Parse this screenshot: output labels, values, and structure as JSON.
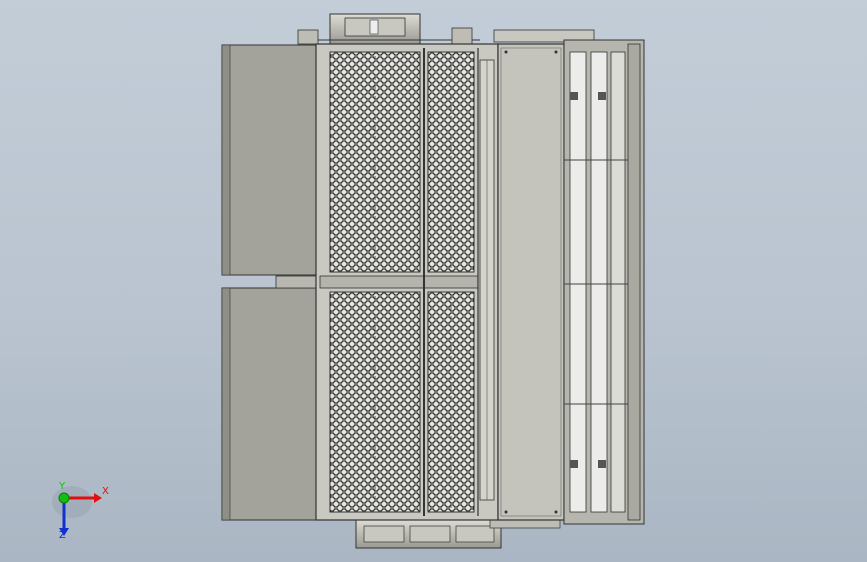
{
  "viewport": {
    "background_top": "#c3cdd8",
    "background_bottom": "#aab6c3",
    "model_icon": "machine-assembly-top-view"
  },
  "triad": {
    "x_label": "X",
    "y_label": "Y",
    "z_label": "Z",
    "x_color": "#e01010",
    "y_color": "#10c010",
    "z_color": "#1030d0"
  }
}
